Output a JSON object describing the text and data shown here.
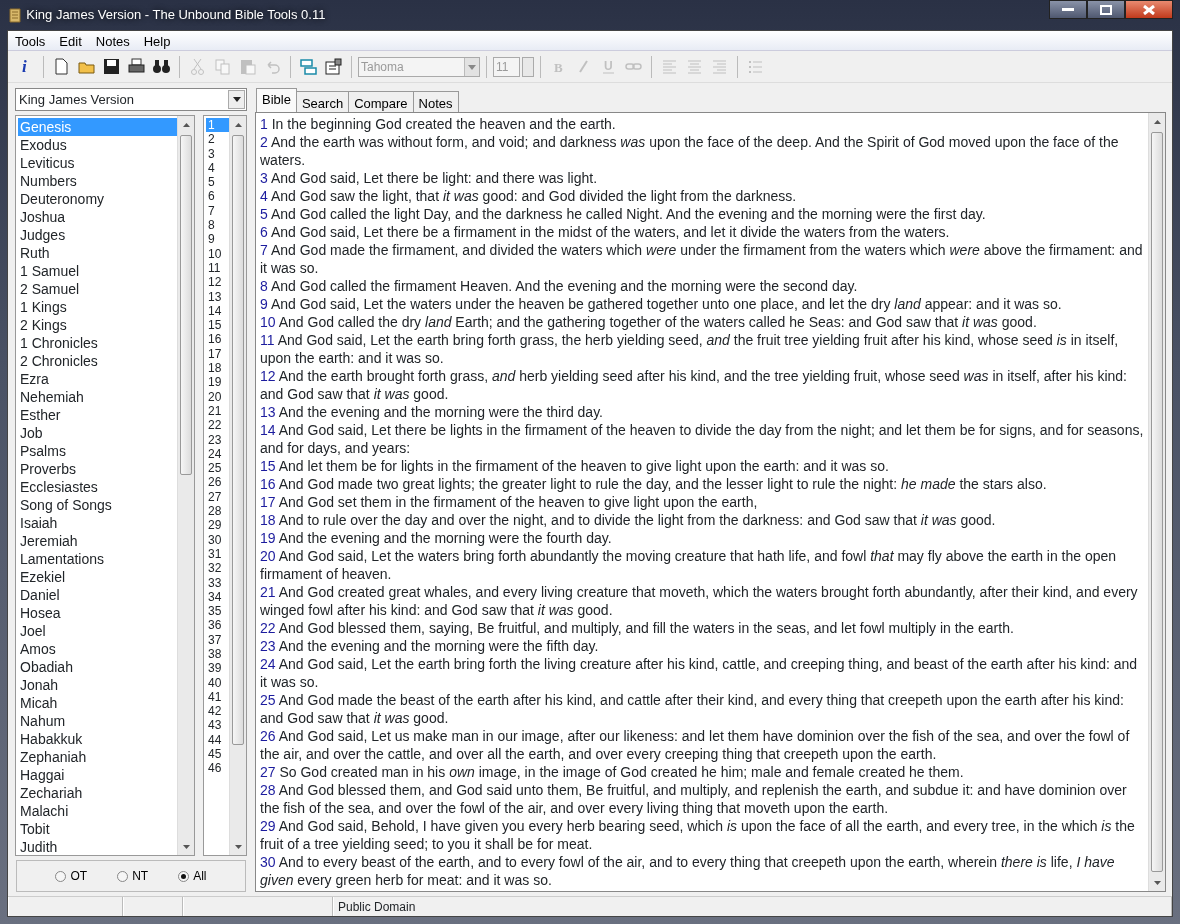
{
  "window": {
    "title": "King James Version - The Unbound Bible Tools 0.11"
  },
  "menu": [
    "Tools",
    "Edit",
    "Notes",
    "Help"
  ],
  "toolbar": [
    {
      "kind": "info",
      "glyph": "i",
      "disabled": false
    },
    {
      "kind": "sep"
    },
    {
      "kind": "new",
      "disabled": false
    },
    {
      "kind": "open",
      "disabled": false
    },
    {
      "kind": "save",
      "disabled": false
    },
    {
      "kind": "print",
      "disabled": false
    },
    {
      "kind": "find",
      "disabled": false
    },
    {
      "kind": "sep"
    },
    {
      "kind": "cut",
      "disabled": true
    },
    {
      "kind": "copy",
      "disabled": true
    },
    {
      "kind": "paste",
      "disabled": true
    },
    {
      "kind": "undo",
      "disabled": true
    },
    {
      "kind": "sep"
    },
    {
      "kind": "compare",
      "disabled": false
    },
    {
      "kind": "options",
      "disabled": false
    },
    {
      "kind": "sep"
    },
    {
      "kind": "font",
      "value": "Tahoma",
      "disabled": true
    },
    {
      "kind": "sep"
    },
    {
      "kind": "size",
      "value": "11",
      "disabled": true
    },
    {
      "kind": "sep"
    },
    {
      "kind": "bold",
      "glyph": "B",
      "disabled": true
    },
    {
      "kind": "italic",
      "disabled": true
    },
    {
      "kind": "underline",
      "glyph": "U",
      "disabled": true
    },
    {
      "kind": "link",
      "disabled": true
    },
    {
      "kind": "sep"
    },
    {
      "kind": "align-left",
      "disabled": true
    },
    {
      "kind": "align-center",
      "disabled": true
    },
    {
      "kind": "align-right",
      "disabled": true
    },
    {
      "kind": "sep"
    },
    {
      "kind": "bullets",
      "disabled": true
    }
  ],
  "version_select": {
    "value": "King James Version"
  },
  "books": [
    {
      "label": "Genesis",
      "selected": true
    },
    {
      "label": "Exodus",
      "selected": false
    },
    {
      "label": "Leviticus",
      "selected": false
    },
    {
      "label": "Numbers",
      "selected": false
    },
    {
      "label": "Deuteronomy",
      "selected": false
    },
    {
      "label": "Joshua",
      "selected": false
    },
    {
      "label": "Judges",
      "selected": false
    },
    {
      "label": "Ruth",
      "selected": false
    },
    {
      "label": "1 Samuel",
      "selected": false
    },
    {
      "label": "2 Samuel",
      "selected": false
    },
    {
      "label": "1 Kings",
      "selected": false
    },
    {
      "label": "2 Kings",
      "selected": false
    },
    {
      "label": "1 Chronicles",
      "selected": false
    },
    {
      "label": "2 Chronicles",
      "selected": false
    },
    {
      "label": "Ezra",
      "selected": false
    },
    {
      "label": "Nehemiah",
      "selected": false
    },
    {
      "label": "Esther",
      "selected": false
    },
    {
      "label": "Job",
      "selected": false
    },
    {
      "label": "Psalms",
      "selected": false
    },
    {
      "label": "Proverbs",
      "selected": false
    },
    {
      "label": "Ecclesiastes",
      "selected": false
    },
    {
      "label": "Song of Songs",
      "selected": false
    },
    {
      "label": "Isaiah",
      "selected": false
    },
    {
      "label": "Jeremiah",
      "selected": false
    },
    {
      "label": "Lamentations",
      "selected": false
    },
    {
      "label": "Ezekiel",
      "selected": false
    },
    {
      "label": "Daniel",
      "selected": false
    },
    {
      "label": "Hosea",
      "selected": false
    },
    {
      "label": "Joel",
      "selected": false
    },
    {
      "label": "Amos",
      "selected": false
    },
    {
      "label": "Obadiah",
      "selected": false
    },
    {
      "label": "Jonah",
      "selected": false
    },
    {
      "label": "Micah",
      "selected": false
    },
    {
      "label": "Nahum",
      "selected": false
    },
    {
      "label": "Habakkuk",
      "selected": false
    },
    {
      "label": "Zephaniah",
      "selected": false
    },
    {
      "label": "Haggai",
      "selected": false
    },
    {
      "label": "Zechariah",
      "selected": false
    },
    {
      "label": "Malachi",
      "selected": false
    },
    {
      "label": "Tobit",
      "selected": false
    },
    {
      "label": "Judith",
      "selected": false
    }
  ],
  "chapters": [
    {
      "label": "1",
      "selected": true
    },
    {
      "label": "2",
      "selected": false
    },
    {
      "label": "3",
      "selected": false
    },
    {
      "label": "4",
      "selected": false
    },
    {
      "label": "5",
      "selected": false
    },
    {
      "label": "6",
      "selected": false
    },
    {
      "label": "7",
      "selected": false
    },
    {
      "label": "8",
      "selected": false
    },
    {
      "label": "9",
      "selected": false
    },
    {
      "label": "10",
      "selected": false
    },
    {
      "label": "11",
      "selected": false
    },
    {
      "label": "12",
      "selected": false
    },
    {
      "label": "13",
      "selected": false
    },
    {
      "label": "14",
      "selected": false
    },
    {
      "label": "15",
      "selected": false
    },
    {
      "label": "16",
      "selected": false
    },
    {
      "label": "17",
      "selected": false
    },
    {
      "label": "18",
      "selected": false
    },
    {
      "label": "19",
      "selected": false
    },
    {
      "label": "20",
      "selected": false
    },
    {
      "label": "21",
      "selected": false
    },
    {
      "label": "22",
      "selected": false
    },
    {
      "label": "23",
      "selected": false
    },
    {
      "label": "24",
      "selected": false
    },
    {
      "label": "25",
      "selected": false
    },
    {
      "label": "26",
      "selected": false
    },
    {
      "label": "27",
      "selected": false
    },
    {
      "label": "28",
      "selected": false
    },
    {
      "label": "29",
      "selected": false
    },
    {
      "label": "30",
      "selected": false
    },
    {
      "label": "31",
      "selected": false
    },
    {
      "label": "32",
      "selected": false
    },
    {
      "label": "33",
      "selected": false
    },
    {
      "label": "34",
      "selected": false
    },
    {
      "label": "35",
      "selected": false
    },
    {
      "label": "36",
      "selected": false
    },
    {
      "label": "37",
      "selected": false
    },
    {
      "label": "38",
      "selected": false
    },
    {
      "label": "39",
      "selected": false
    },
    {
      "label": "40",
      "selected": false
    },
    {
      "label": "41",
      "selected": false
    },
    {
      "label": "42",
      "selected": false
    },
    {
      "label": "43",
      "selected": false
    },
    {
      "label": "44",
      "selected": false
    },
    {
      "label": "45",
      "selected": false
    },
    {
      "label": "46",
      "selected": false
    }
  ],
  "testament": [
    {
      "label": "OT",
      "selected": false
    },
    {
      "label": "NT",
      "selected": false
    },
    {
      "label": "All",
      "selected": true
    }
  ],
  "tabs": [
    {
      "label": "Bible",
      "selected": true
    },
    {
      "label": "Search",
      "selected": false
    },
    {
      "label": "Compare",
      "selected": false
    },
    {
      "label": "Notes",
      "selected": false
    }
  ],
  "verses": [
    {
      "num": "1",
      "text": "In the beginning God created the heaven and the earth."
    },
    {
      "num": "2",
      "text": "And the earth was without form, and void; and darkness *was* upon the face of the deep. And the Spirit of God moved upon the face of the waters."
    },
    {
      "num": "3",
      "text": "And God said, Let there be light: and there was light."
    },
    {
      "num": "4",
      "text": "And God saw the light, that *it was* good: and God divided the light from the darkness."
    },
    {
      "num": "5",
      "text": "And God called the light Day, and the darkness he called Night. And the evening and the morning were the first day."
    },
    {
      "num": "6",
      "text": "And God said, Let there be a firmament in the midst of the waters, and let it divide the waters from the waters."
    },
    {
      "num": "7",
      "text": "And God made the firmament, and divided the waters which *were* under the firmament from the waters which *were* above the firmament: and it was so."
    },
    {
      "num": "8",
      "text": "And God called the firmament Heaven. And the evening and the morning were the second day."
    },
    {
      "num": "9",
      "text": "And God said, Let the waters under the heaven be gathered together unto one place, and let the dry *land* appear: and it was so."
    },
    {
      "num": "10",
      "text": "And God called the dry *land* Earth; and the gathering together of the waters called he Seas: and God saw that *it was* good."
    },
    {
      "num": "11",
      "text": "And God said, Let the earth bring forth grass, the herb yielding seed, *and* the fruit tree yielding fruit after his kind, whose seed *is* in itself, upon the earth: and it was so."
    },
    {
      "num": "12",
      "text": "And the earth brought forth grass, *and* herb yielding seed after his kind, and the tree yielding fruit, whose seed *was* in itself, after his kind: and God saw that *it was* good."
    },
    {
      "num": "13",
      "text": "And the evening and the morning were the third day."
    },
    {
      "num": "14",
      "text": "And God said, Let there be lights in the firmament of the heaven to divide the day from the night; and let them be for signs, and for seasons, and for days, and years:"
    },
    {
      "num": "15",
      "text": "And let them be for lights in the firmament of the heaven to give light upon the earth: and it was so."
    },
    {
      "num": "16",
      "text": "And God made two great lights; the greater light to rule the day, and the lesser light to rule the night: *he made* the stars also."
    },
    {
      "num": "17",
      "text": "And God set them in the firmament of the heaven to give light upon the earth,"
    },
    {
      "num": "18",
      "text": "And to rule over the day and over the night, and to divide the light from the darkness: and God saw that *it was* good."
    },
    {
      "num": "19",
      "text": "And the evening and the morning were the fourth day."
    },
    {
      "num": "20",
      "text": "And God said, Let the waters bring forth abundantly the moving creature that hath life, and fowl *that* may fly above the earth in the open firmament of heaven."
    },
    {
      "num": "21",
      "text": "And God created great whales, and every living creature that moveth, which the waters brought forth abundantly, after their kind, and every winged fowl after his kind: and God saw that *it was* good."
    },
    {
      "num": "22",
      "text": "And God blessed them, saying, Be fruitful, and multiply, and fill the waters in the seas, and let fowl multiply in the earth."
    },
    {
      "num": "23",
      "text": "And the evening and the morning were the fifth day."
    },
    {
      "num": "24",
      "text": "And God said, Let the earth bring forth the living creature after his kind, cattle, and creeping thing, and beast of the earth after his kind: and it was so."
    },
    {
      "num": "25",
      "text": "And God made the beast of the earth after his kind, and cattle after their kind, and every thing that creepeth upon the earth after his kind: and God saw that *it was* good."
    },
    {
      "num": "26",
      "text": "And God said, Let us make man in our image, after our likeness: and let them have dominion over the fish of the sea, and over the fowl of the air, and over the cattle, and over all the earth, and over every creeping thing that creepeth upon the earth."
    },
    {
      "num": "27",
      "text": "So God created man in his *own* image, in the image of God created he him; male and female created he them."
    },
    {
      "num": "28",
      "text": "And God blessed them, and God said unto them, Be fruitful, and multiply, and replenish the earth, and subdue it: and have dominion over the fish of the sea, and over the fowl of the air, and over every living thing that moveth upon the earth."
    },
    {
      "num": "29",
      "text": "And God said, Behold, I have given you every herb bearing seed, which *is* upon the face of all the earth, and every tree, in the which *is* the fruit of a tree yielding seed; to you it shall be for meat."
    },
    {
      "num": "30",
      "text": "And to every beast of the earth, and to every fowl of the air, and to every thing that creepeth upon the earth, wherein *there is* life, *I have given* every green herb for meat: and it was so."
    }
  ],
  "status_bar": {
    "text": "Public Domain"
  }
}
